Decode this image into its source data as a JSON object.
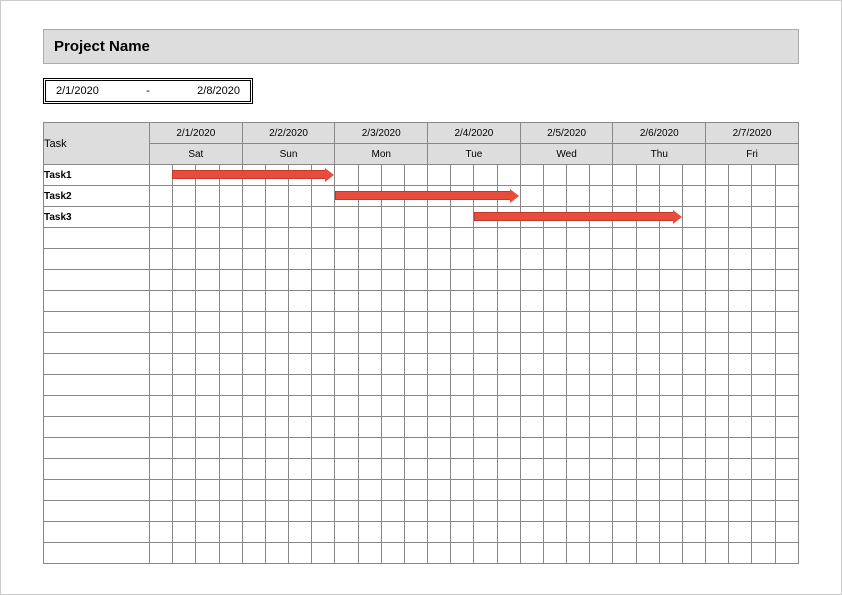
{
  "title": "Project Name",
  "date_range": {
    "start": "2/1/2020",
    "sep": "-",
    "end": "2/8/2020"
  },
  "task_header": "Task",
  "columns": [
    {
      "date": "2/1/2020",
      "day": "Sat"
    },
    {
      "date": "2/2/2020",
      "day": "Sun"
    },
    {
      "date": "2/3/2020",
      "day": "Mon"
    },
    {
      "date": "2/4/2020",
      "day": "Tue"
    },
    {
      "date": "2/5/2020",
      "day": "Wed"
    },
    {
      "date": "2/6/2020",
      "day": "Thu"
    },
    {
      "date": "2/7/2020",
      "day": "Fri"
    }
  ],
  "sub_splits": 4,
  "tasks": [
    {
      "name": "Task1",
      "start_col": 0,
      "start_sub": 1,
      "end_col": 2,
      "end_sub": 0
    },
    {
      "name": "Task2",
      "start_col": 2,
      "start_sub": 0,
      "end_col": 4,
      "end_sub": 0
    },
    {
      "name": "Task3",
      "start_col": 3,
      "start_sub": 2,
      "end_col": 5,
      "end_sub": 3
    }
  ],
  "empty_rows": 16,
  "chart_data": {
    "type": "bar",
    "title": "Project Name",
    "categories": [
      "2/1/2020",
      "2/2/2020",
      "2/3/2020",
      "2/4/2020",
      "2/5/2020",
      "2/6/2020",
      "2/7/2020"
    ],
    "x": [
      "Sat",
      "Sun",
      "Mon",
      "Tue",
      "Wed",
      "Thu",
      "Fri"
    ],
    "series": [
      {
        "name": "Task1",
        "start": "2/1/2020",
        "end": "2/3/2020"
      },
      {
        "name": "Task2",
        "start": "2/3/2020",
        "end": "2/5/2020"
      },
      {
        "name": "Task3",
        "start": "2/4/2020",
        "end": "2/6/2020"
      }
    ]
  }
}
